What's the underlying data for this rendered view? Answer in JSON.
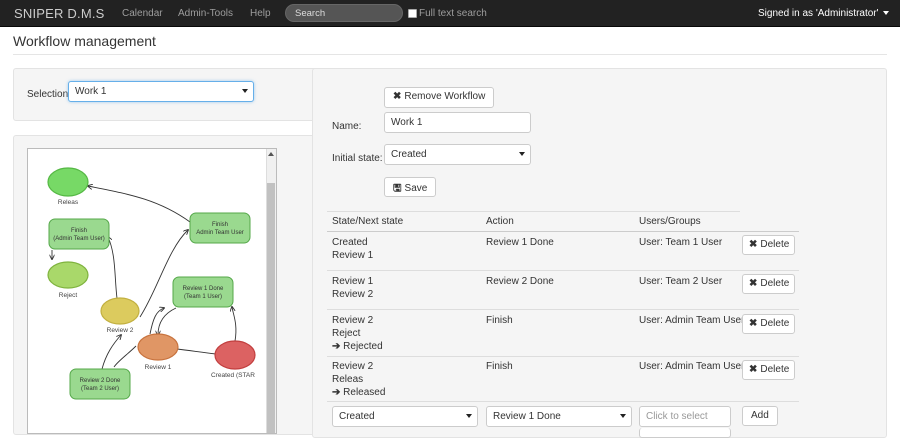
{
  "navbar": {
    "brand": "SNIPER D.M.S",
    "links": [
      "Calendar",
      "Admin-Tools",
      "Help"
    ],
    "search_placeholder": "Search",
    "fulltext_label": "Full text search",
    "user_label": "Signed in as 'Administrator'"
  },
  "page": {
    "title": "Workflow management"
  },
  "selection": {
    "label": "Selection:",
    "value": "Work 1"
  },
  "graph": {
    "nodes": [
      {
        "label": "Releas",
        "color": "#77d966"
      },
      {
        "label": "Finish\n(Admin Team User)",
        "color": "#9ad98f"
      },
      {
        "label": "Finish\nAdmin Team User",
        "color": "#9ad98f"
      },
      {
        "label": "Reject",
        "color": "#a9d86a"
      },
      {
        "label": "Review 1 Done\n(Team 1 User)",
        "color": "#9ad98f"
      },
      {
        "label": "Review 2",
        "color": "#dccb5e"
      },
      {
        "label": "Review 1",
        "color": "#e09665"
      },
      {
        "label": "Created (STAR",
        "color": "#dc6262"
      },
      {
        "label": "Review 2 Done\n(Team 2 User)",
        "color": "#9ad98f"
      }
    ]
  },
  "form": {
    "remove_label": "Remove Workflow",
    "name_label": "Name:",
    "name_value": "Work 1",
    "initial_label": "Initial state:",
    "initial_value": "Created",
    "save_label": "Save"
  },
  "table": {
    "headers": [
      "State/Next state",
      "Action",
      "Users/Groups"
    ],
    "rows": [
      {
        "state": "Created",
        "next": "Review 1",
        "extra": "",
        "action": "Review 1 Done",
        "users": "User: Team 1 User"
      },
      {
        "state": "Review 1",
        "next": "Review 2",
        "extra": "",
        "action": "Review 2 Done",
        "users": "User: Team 2 User"
      },
      {
        "state": "Review 2",
        "next": "Reject",
        "extra": "Rejected",
        "action": "Finish",
        "users": "User: Admin Team User"
      },
      {
        "state": "Review 2",
        "next": "Releas",
        "extra": "Released",
        "action": "Finish",
        "users": "User: Admin Team User"
      }
    ],
    "delete_label": "Delete",
    "add_row": {
      "state_value": "Created",
      "action_value": "Review 1 Done",
      "users_placeholder": "Click to select",
      "add_label": "Add"
    }
  }
}
